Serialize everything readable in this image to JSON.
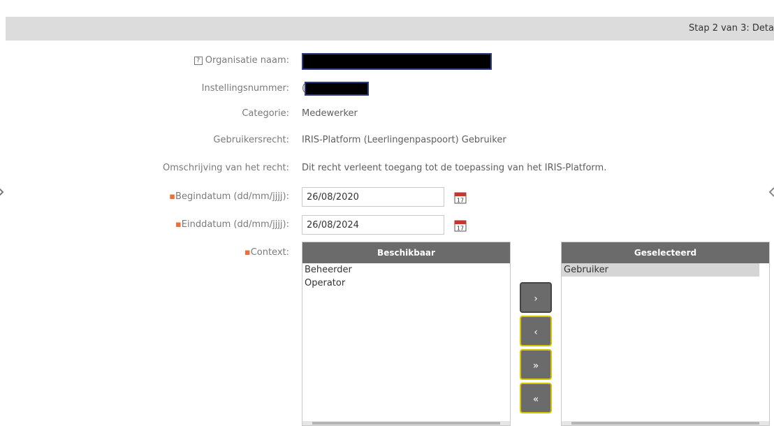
{
  "step": {
    "text": "Stap 2 van 3: Deta"
  },
  "form": {
    "org_name_label": "Organisatie naam:",
    "institution_label": "Instellingsnummer:",
    "institution_prefix": "(",
    "category_label": "Categorie:",
    "category_value": "Medewerker",
    "right_label": "Gebruikersrecht:",
    "right_value": "IRIS-Platform (Leerlingenpaspoort) Gebruiker",
    "desc_label": "Omschrijving van het recht:",
    "desc_value": "Dit recht verleent toegang tot de toepassing van het IRIS-Platform.",
    "start_label_prefix": "Begindatum (dd/mm/",
    "start_label_u": "jjjj",
    "start_label_suffix": "):",
    "start_value": "26/08/2020",
    "end_label_prefix": "Einddatum (dd/mm/",
    "end_label_u": "jjjj",
    "end_label_suffix": "):",
    "end_value": "26/08/2024",
    "context_label": "Context:",
    "required_marker": "▪"
  },
  "calendar_icon_text": "17",
  "available": {
    "header": "Beschikbaar",
    "items": [
      "Beheerder",
      "Operator"
    ]
  },
  "selected": {
    "header": "Geselecteerd",
    "items": [
      "Gebruiker"
    ]
  },
  "buttons": {
    "add": "›",
    "remove": "‹",
    "add_all": "»",
    "remove_all": "«"
  },
  "colors": {
    "required": "#e8703a",
    "list_header": "#6b6b6b",
    "button_border": "#d4c400",
    "step_bar": "#dcdcdc"
  }
}
